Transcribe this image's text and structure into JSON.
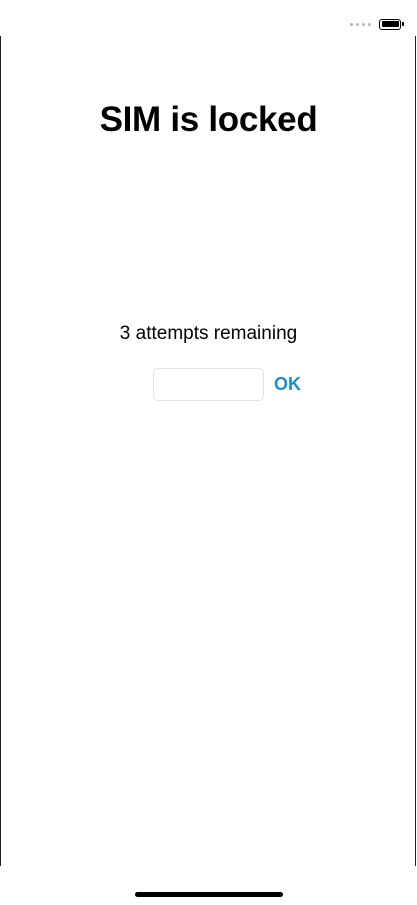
{
  "screen": {
    "title": "SIM is locked",
    "attempts_text": "3 attempts remaining",
    "pin_input": {
      "value": "",
      "placeholder": ""
    },
    "ok_label": "OK"
  },
  "status_bar": {
    "signal_icon": "signal-dots-icon",
    "battery_icon": "battery-icon"
  },
  "colors": {
    "accent": "#1a8fd0",
    "background": "#ffffff",
    "text": "#000000"
  }
}
